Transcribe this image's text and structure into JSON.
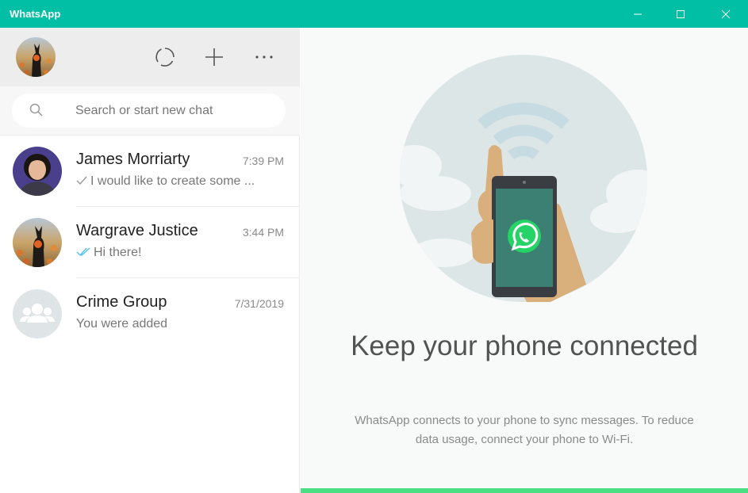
{
  "window": {
    "title": "WhatsApp",
    "controls": {
      "minimize": "minimize",
      "maximize": "maximize",
      "close": "close"
    },
    "accent_color": "#00bfa5"
  },
  "sidebar": {
    "header": {
      "actions": [
        {
          "icon": "status-icon"
        },
        {
          "icon": "plus-icon"
        },
        {
          "icon": "more-icon"
        }
      ]
    },
    "search": {
      "placeholder": "Search or start new chat"
    },
    "chats": [
      {
        "name": "James Morriarty",
        "time": "7:39 PM",
        "preview": "I would like to create some ...",
        "tick": "single"
      },
      {
        "name": "Wargrave Justice",
        "time": "3:44 PM",
        "preview": "Hi there!",
        "tick": "double-read"
      },
      {
        "name": "Crime Group",
        "time": "7/31/2019",
        "preview": "You were added",
        "tick": "none"
      }
    ]
  },
  "main": {
    "title": "Keep your phone connected",
    "description": "WhatsApp connects to your phone to sync messages. To reduce data usage, connect your phone to Wi-Fi.",
    "bar_color": "#4adf83"
  }
}
